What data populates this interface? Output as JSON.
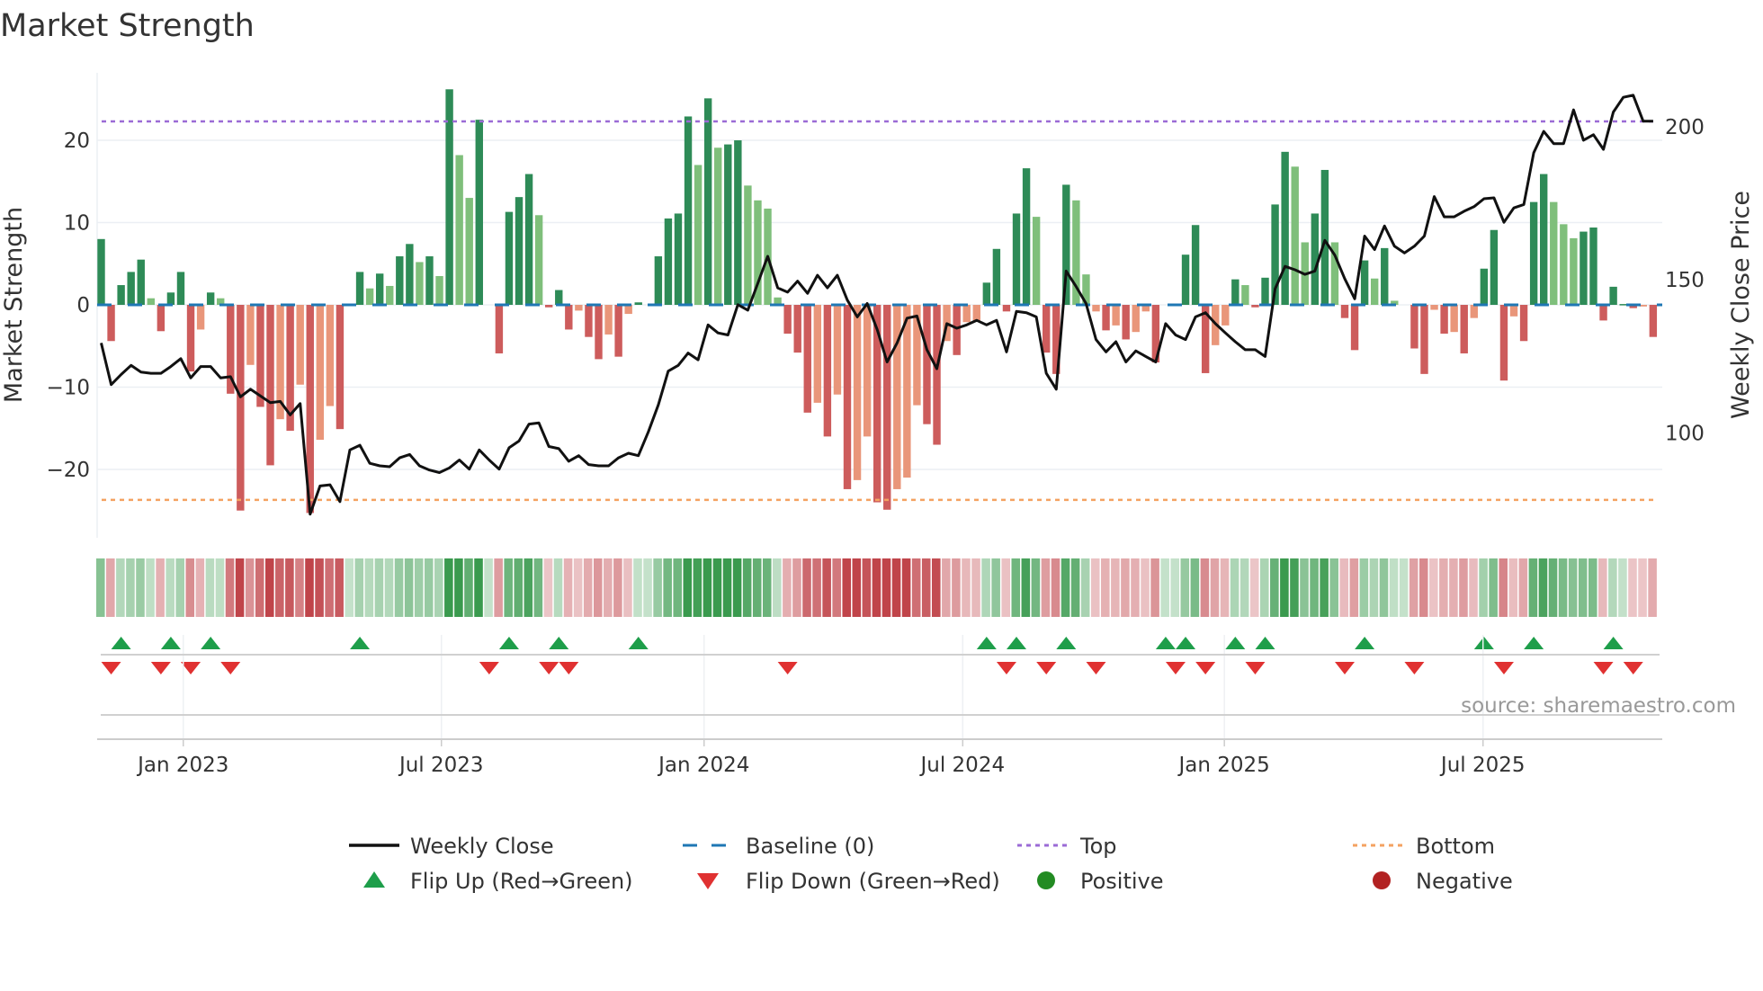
{
  "chart_data": {
    "type": "bar",
    "title": "Market Strength",
    "ylabel": "Market Strength",
    "y2label": "Weekly Close Price",
    "source": "source: sharemaestro.com",
    "start_week": "2022-11-04",
    "frequency": "weekly",
    "ylim": [
      -28.4,
      28.2
    ],
    "y2lim": [
      65.8,
      217.6
    ],
    "yticks": [
      {
        "v": 20,
        "label": "20"
      },
      {
        "v": 10,
        "label": "10"
      },
      {
        "v": 0,
        "label": "0"
      },
      {
        "v": -10,
        "label": "−10"
      },
      {
        "v": -20,
        "label": "−20"
      }
    ],
    "y2ticks": [
      {
        "v": 200,
        "label": "200"
      },
      {
        "v": 150,
        "label": "150"
      },
      {
        "v": 100,
        "label": "100"
      }
    ],
    "xticks": [
      {
        "week": 8.25,
        "label": "Jan 2023"
      },
      {
        "week": 34.2,
        "label": "Jul 2023"
      },
      {
        "week": 60.6,
        "label": "Jan 2024"
      },
      {
        "week": 86.6,
        "label": "Jul 2024"
      },
      {
        "week": 112.9,
        "label": "Jan 2025"
      },
      {
        "week": 138.9,
        "label": "Jul 2025"
      }
    ],
    "top_level": 22.3,
    "bottom_level": -23.7,
    "baseline": 0,
    "strength": [
      8.0,
      -4.4,
      2.4,
      4.0,
      5.5,
      0.8,
      -3.2,
      1.5,
      4.0,
      -8.1,
      -3.0,
      1.5,
      0.8,
      -10.8,
      -25.0,
      -7.3,
      -12.4,
      -19.5,
      -13.9,
      -15.3,
      -9.7,
      -25.3,
      -16.4,
      -12.3,
      -15.1,
      0,
      4.0,
      2.0,
      3.8,
      2.3,
      5.9,
      7.4,
      5.2,
      5.9,
      3.5,
      26.2,
      18.2,
      13.0,
      22.5,
      0,
      -5.9,
      11.3,
      13.1,
      15.9,
      10.9,
      -0.3,
      1.8,
      -3.0,
      -0.7,
      -3.9,
      -6.6,
      -3.6,
      -6.3,
      -1.1,
      0.3,
      0,
      5.9,
      10.5,
      11.1,
      22.9,
      17.0,
      25.1,
      19.1,
      19.5,
      20.0,
      14.5,
      12.7,
      11.7,
      0.9,
      -3.5,
      -5.8,
      -13.1,
      -11.9,
      -16.0,
      -10.9,
      -22.4,
      -21.3,
      -16.0,
      -24.0,
      -24.9,
      -22.4,
      -21.0,
      -12.2,
      -14.5,
      -17.0,
      -4.4,
      -6.1,
      -2.1,
      -1.9,
      2.7,
      6.8,
      -0.8,
      11.1,
      16.6,
      10.7,
      -5.8,
      -8.4,
      14.6,
      12.7,
      3.7,
      -0.8,
      -3.1,
      -2.5,
      -4.2,
      -3.3,
      -0.8,
      -7.0,
      0,
      0,
      6.1,
      9.7,
      -8.3,
      -4.9,
      -2.5,
      3.1,
      2.4,
      -0.3,
      3.3,
      12.2,
      18.6,
      16.8,
      7.6,
      11.1,
      16.4,
      7.6,
      -1.6,
      -5.5,
      5.4,
      3.2,
      6.9,
      0.5,
      0,
      -5.3,
      -8.4,
      -0.6,
      -3.5,
      -3.3,
      -5.9,
      -1.6,
      4.4,
      9.1,
      -9.2,
      -1.4,
      -4.4,
      12.5,
      15.9,
      12.5,
      9.8,
      8.1,
      8.9,
      9.4,
      -1.9,
      2.2,
      0.1,
      -0.4,
      -0.2,
      -3.9
    ],
    "weakening_weeks": [
      5,
      10,
      12,
      15,
      18,
      20,
      22,
      23,
      27,
      29,
      32,
      34,
      36,
      37,
      44,
      48,
      51,
      53,
      60,
      62,
      65,
      66,
      67,
      68,
      72,
      74,
      76,
      77,
      80,
      81,
      82,
      85,
      87,
      88,
      94,
      98,
      99,
      100,
      102,
      104,
      105,
      112,
      113,
      115,
      120,
      121,
      124,
      128,
      130,
      134,
      136,
      138,
      142,
      146,
      147,
      148,
      155
    ],
    "weekly_close": [
      129.4,
      115.8,
      119.1,
      122.1,
      119.9,
      119.5,
      119.5,
      121.7,
      124.3,
      118.0,
      121.7,
      121.7,
      118.0,
      118.4,
      111.8,
      114.3,
      112.1,
      109.9,
      110.3,
      105.9,
      109.6,
      73.5,
      82.7,
      83.1,
      77.6,
      94.5,
      96.0,
      90.1,
      89.3,
      89.0,
      91.9,
      93.0,
      89.3,
      87.9,
      87.1,
      88.6,
      91.2,
      88.2,
      94.5,
      91.2,
      88.2,
      95.2,
      97.4,
      102.9,
      103.3,
      95.6,
      94.9,
      90.8,
      92.6,
      89.7,
      89.3,
      89.3,
      91.9,
      93.4,
      92.6,
      100.4,
      109.2,
      120.2,
      122.1,
      126.1,
      123.9,
      135.3,
      132.7,
      132.0,
      141.9,
      140.1,
      148.9,
      157.7,
      147.4,
      146.0,
      149.6,
      145.6,
      151.5,
      147.4,
      151.5,
      143.4,
      137.9,
      142.3,
      133.8,
      123.2,
      129.4,
      137.5,
      138.2,
      127.2,
      121.0,
      135.7,
      134.2,
      135.3,
      136.8,
      135.3,
      136.8,
      126.5,
      139.7,
      139.3,
      137.9,
      119.5,
      114.3,
      152.9,
      147.8,
      142.3,
      130.5,
      126.5,
      129.8,
      123.2,
      126.8,
      125.0,
      123.2,
      135.7,
      132.0,
      130.5,
      137.9,
      139.3,
      135.7,
      132.7,
      129.8,
      127.2,
      127.2,
      125.0,
      147.1,
      154.4,
      153.3,
      151.8,
      152.9,
      162.9,
      158.1,
      150.4,
      143.8,
      164.3,
      159.9,
      167.6,
      161.0,
      158.8,
      161.0,
      164.3,
      177.2,
      170.6,
      170.6,
      172.4,
      173.9,
      176.5,
      176.8,
      168.8,
      173.5,
      174.6,
      191.5,
      198.5,
      194.5,
      194.5,
      205.5,
      195.6,
      197.4,
      192.6,
      204.8,
      209.6,
      210.3,
      201.8,
      201.8
    ],
    "flip_up_weeks": [
      2,
      7,
      11,
      26,
      41,
      46,
      54,
      89,
      92,
      97,
      107,
      109,
      114,
      117,
      127,
      139,
      144,
      152
    ],
    "flip_down_weeks": [
      1,
      6,
      9,
      13,
      39,
      45,
      47,
      69,
      91,
      95,
      100,
      108,
      111,
      116,
      125,
      132,
      141,
      151,
      154
    ],
    "legend": [
      {
        "label": "Weekly Close",
        "kind": "line",
        "color": "#111111"
      },
      {
        "label": "Baseline (0)",
        "kind": "dash",
        "color": "#1f77b4"
      },
      {
        "label": "Top",
        "kind": "dot",
        "color": "#9b6bd6"
      },
      {
        "label": "Bottom",
        "kind": "dot",
        "color": "#f4a261"
      },
      {
        "label": "Flip Up (Red→Green)",
        "kind": "up",
        "color": "#1e9e4a"
      },
      {
        "label": "Flip Down (Green→Red)",
        "kind": "down",
        "color": "#e03131"
      },
      {
        "label": "Positive",
        "kind": "circle",
        "color": "#228b22"
      },
      {
        "label": "Negative",
        "kind": "circle",
        "color": "#b22222"
      }
    ],
    "colors": {
      "pos_strong": "#2e8b57",
      "pos_weak": "#7fbf7b",
      "neg_strong": "#cd5c5c",
      "neg_weak": "#e9967a",
      "top": "#9b6bd6",
      "bottom": "#f4a261",
      "baseline": "#1f77b4",
      "close": "#111111"
    }
  }
}
